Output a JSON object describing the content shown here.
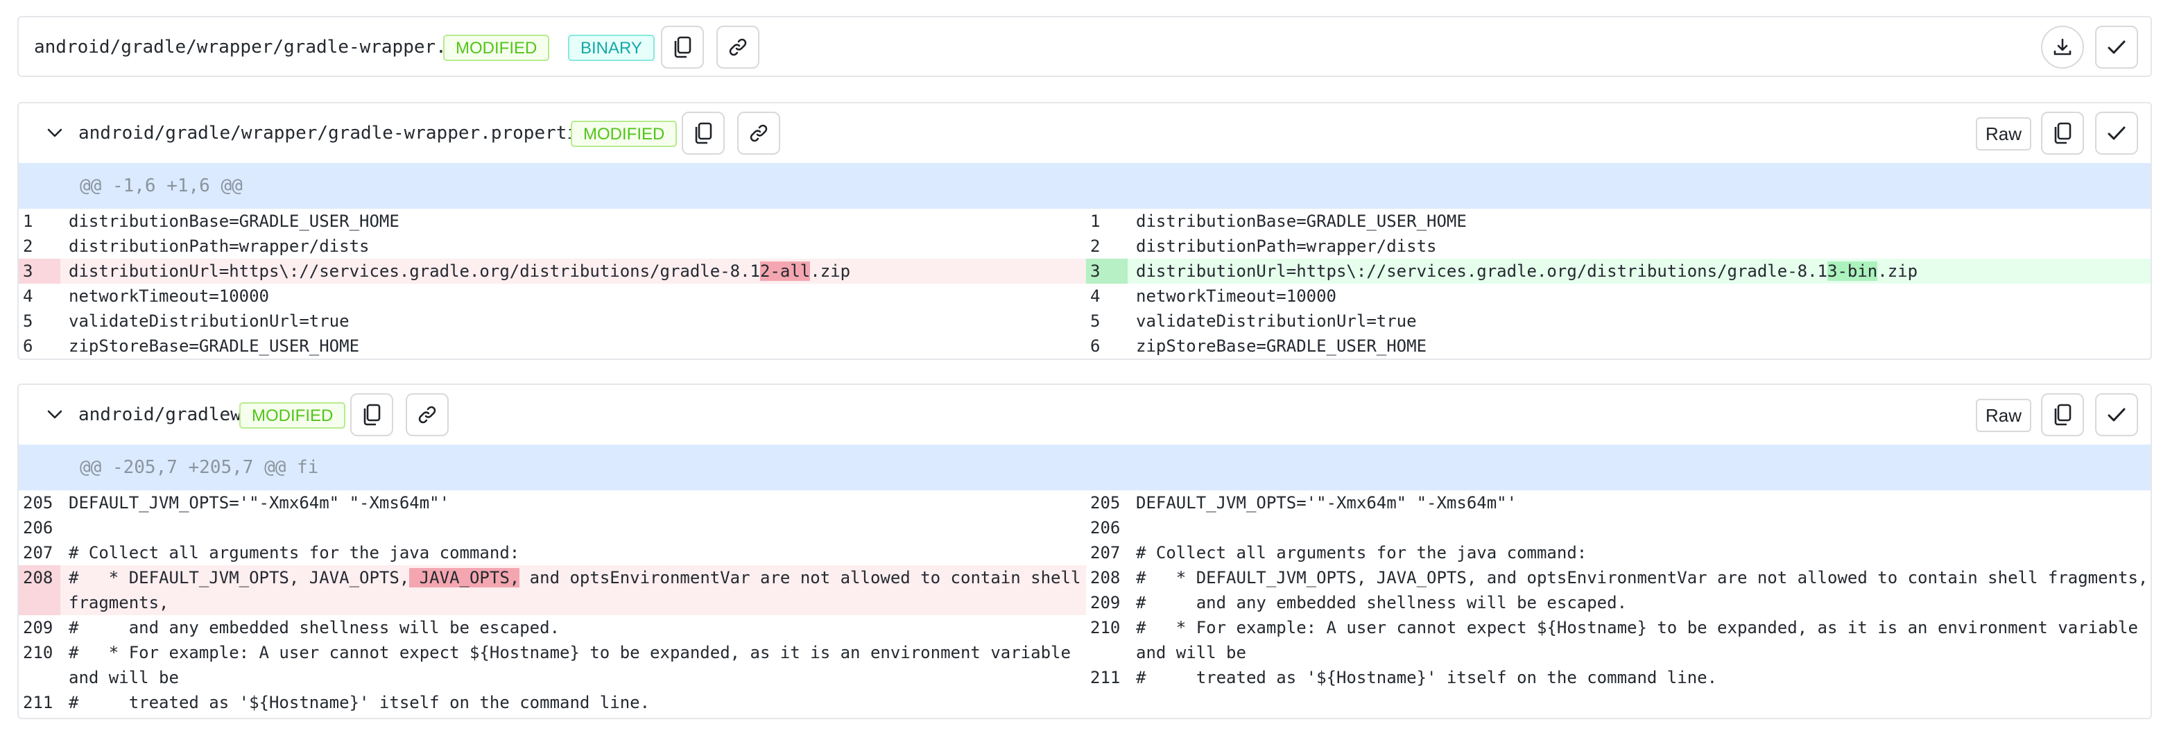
{
  "files": [
    {
      "path": "android/gradle/wrapper/gradle-wrapper.jar",
      "status": "MODIFIED",
      "binary_label": "BINARY"
    },
    {
      "path": "android/gradle/wrapper/gradle-wrapper.properties",
      "status": "MODIFIED",
      "raw_label": "Raw",
      "hunk": "@@ -1,6 +1,6 @@",
      "left": [
        {
          "ln": "1",
          "code": "distributionBase=GRADLE_USER_HOME"
        },
        {
          "ln": "2",
          "code": "distributionPath=wrapper/dists"
        },
        {
          "ln": "3",
          "pre": "distributionUrl=https\\://services.gradle.org/distributions/gradle-8.1",
          "hl": "2-all",
          "post": ".zip"
        },
        {
          "ln": "4",
          "code": "networkTimeout=10000"
        },
        {
          "ln": "5",
          "code": "validateDistributionUrl=true"
        },
        {
          "ln": "6",
          "code": "zipStoreBase=GRADLE_USER_HOME"
        }
      ],
      "right": [
        {
          "ln": "1",
          "code": "distributionBase=GRADLE_USER_HOME"
        },
        {
          "ln": "2",
          "code": "distributionPath=wrapper/dists"
        },
        {
          "ln": "3",
          "pre": "distributionUrl=https\\://services.gradle.org/distributions/gradle-8.1",
          "hl": "3-bin",
          "post": ".zip"
        },
        {
          "ln": "4",
          "code": "networkTimeout=10000"
        },
        {
          "ln": "5",
          "code": "validateDistributionUrl=true"
        },
        {
          "ln": "6",
          "code": "zipStoreBase=GRADLE_USER_HOME"
        }
      ]
    },
    {
      "path": "android/gradlew",
      "status": "MODIFIED",
      "raw_label": "Raw",
      "hunk": "@@ -205,7 +205,7 @@ fi",
      "left": [
        {
          "ln": "205",
          "code": "DEFAULT_JVM_OPTS='\"-Xmx64m\" \"-Xms64m\"'"
        },
        {
          "ln": "206",
          "code": ""
        },
        {
          "ln": "207",
          "code": "# Collect all arguments for the java command:"
        },
        {
          "ln": "208",
          "pre": "#   * DEFAULT_JVM_OPTS, JAVA_OPTS,",
          "hl": " JAVA_OPTS,",
          "post": " and optsEnvironmentVar are not allowed to contain shell fragments,"
        },
        {
          "ln": "209",
          "code": "#     and any embedded shellness will be escaped."
        },
        {
          "ln": "210",
          "code": "#   * For example: A user cannot expect ${Hostname} to be expanded, as it is an environment variable and will be"
        },
        {
          "ln": "211",
          "code": "#     treated as '${Hostname}' itself on the command line."
        }
      ],
      "right": [
        {
          "ln": "205",
          "code": "DEFAULT_JVM_OPTS='\"-Xmx64m\" \"-Xms64m\"'"
        },
        {
          "ln": "206",
          "code": ""
        },
        {
          "ln": "207",
          "code": "# Collect all arguments for the java command:"
        },
        {
          "ln": "208",
          "code": "#   * DEFAULT_JVM_OPTS, JAVA_OPTS, and optsEnvironmentVar are not allowed to contain shell fragments,"
        },
        {
          "ln": "209",
          "code": "#     and any embedded shellness will be escaped."
        },
        {
          "ln": "210",
          "code": "#   * For example: A user cannot expect ${Hostname} to be expanded, as it is an environment variable and will be"
        },
        {
          "ln": "211",
          "code": "#     treated as '${Hostname}' itself on the command line."
        }
      ]
    }
  ],
  "icons": {
    "copy": "copy-icon",
    "link": "link-icon",
    "download": "download-icon",
    "check": "check-icon",
    "chevron": "chevron-down-icon"
  }
}
